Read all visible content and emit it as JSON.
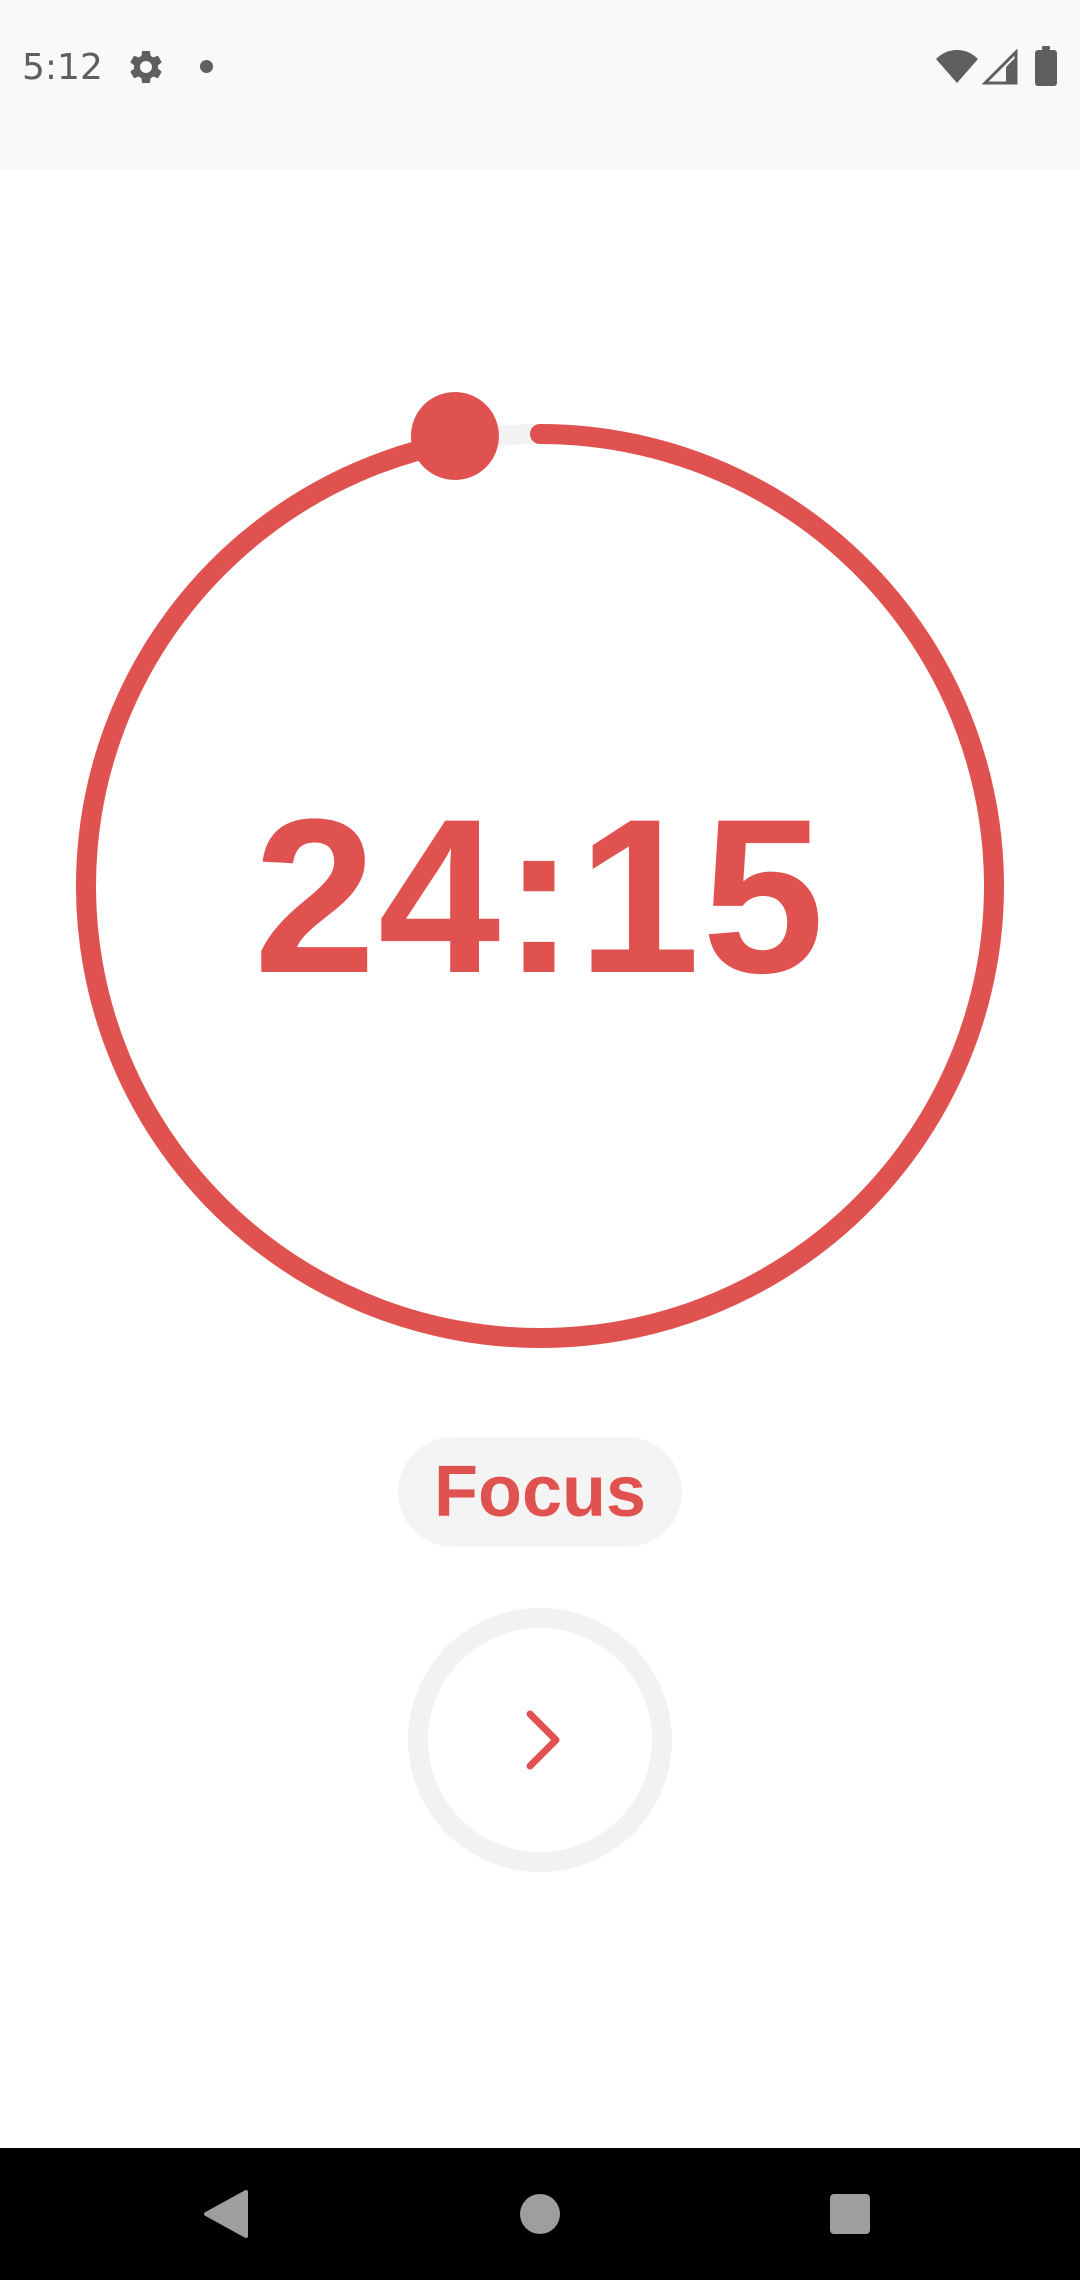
{
  "status_bar": {
    "time": "5:12",
    "icons": [
      "settings-gear-icon",
      "notification-dot-icon",
      "wifi-icon",
      "cell-signal-icon",
      "battery-icon"
    ]
  },
  "timer": {
    "time_text": "24:15",
    "remaining_fraction": 0.97,
    "accent_color": "#e0524f",
    "track_color": "#f2f2f2"
  },
  "mode": {
    "label": "Focus"
  },
  "controls": {
    "next_icon": "chevron-right-icon"
  },
  "nav_bar": {
    "icons": [
      "back-icon",
      "home-icon",
      "recents-icon"
    ]
  }
}
